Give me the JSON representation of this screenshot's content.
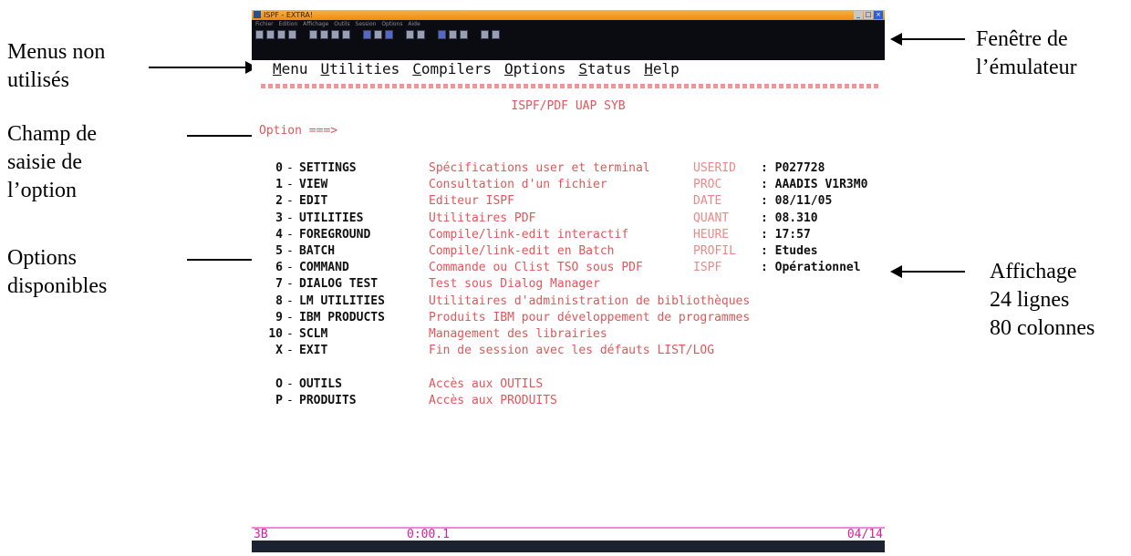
{
  "annotations": {
    "menus_line1": "Menus non",
    "menus_line2": "utilisés",
    "field_line1": "Champ de",
    "field_line2": "saisie de",
    "field_line3": "l’option",
    "options_line1": "Options",
    "options_line2": "disponibles",
    "window_line1": "Fenêtre de",
    "window_line2": "l’émulateur",
    "display_line1": "Affichage",
    "display_line2": "24 lignes",
    "display_line3": "80 colonnes"
  },
  "window": {
    "title": "ISPF - EXTRA!",
    "menu": "Fichier Edition Affichage Outils Session Options Aide",
    "status": "",
    "status_right": ""
  },
  "terminal": {
    "menu": [
      "Menu",
      "Utilities",
      "Compilers",
      "Options",
      "Status",
      "Help"
    ],
    "panel_title": "ISPF/PDF UAP SYB",
    "option_prompt": "Option ===>",
    "options": [
      {
        "key": "0",
        "name": "SETTINGS",
        "desc": "Spécifications user et terminal",
        "label": "USERID",
        "value": ": P027728"
      },
      {
        "key": "1",
        "name": "VIEW",
        "desc": "Consultation d'un fichier",
        "label": "PROC",
        "value": ": AAADIS V1R3M0"
      },
      {
        "key": "2",
        "name": "EDIT",
        "desc": "Editeur ISPF",
        "label": "DATE",
        "value": ": 08/11/05"
      },
      {
        "key": "3",
        "name": "UTILITIES",
        "desc": "Utilitaires PDF",
        "label": "QUANT",
        "value": ": 08.310"
      },
      {
        "key": "4",
        "name": "FOREGROUND",
        "desc": "Compile/link-edit interactif",
        "label": "HEURE",
        "value": ": 17:57"
      },
      {
        "key": "5",
        "name": "BATCH",
        "desc": "Compile/link-edit en Batch",
        "label": "PROFIL",
        "value": ": Etudes"
      },
      {
        "key": "6",
        "name": "COMMAND",
        "desc": "Commande ou Clist TSO sous PDF",
        "label": "ISPF",
        "value": ": Opérationnel"
      },
      {
        "key": "7",
        "name": "DIALOG TEST",
        "desc": "Test sous Dialog Manager",
        "label": "",
        "value": ""
      },
      {
        "key": "8",
        "name": "LM UTILITIES",
        "desc": "Utilitaires d'administration de bibliothèques",
        "label": "",
        "value": ""
      },
      {
        "key": "9",
        "name": "IBM PRODUCTS",
        "desc": "Produits IBM pour développement de programmes",
        "label": "",
        "value": ""
      },
      {
        "key": "10",
        "name": "SCLM",
        "desc": "Management des librairies",
        "label": "",
        "value": ""
      },
      {
        "key": "X",
        "name": "EXIT",
        "desc": "Fin de session avec les défauts LIST/LOG",
        "label": "",
        "value": ""
      },
      {
        "key": "O",
        "name": "OUTILS",
        "desc": "Accès aux OUTILS",
        "label": "",
        "value": ""
      },
      {
        "key": "P",
        "name": "PRODUITS",
        "desc": "Accès aux PRODUITS",
        "label": "",
        "value": ""
      }
    ],
    "status_cursor": "3B",
    "status_time": "0:00.1",
    "status_page": "04/14"
  }
}
